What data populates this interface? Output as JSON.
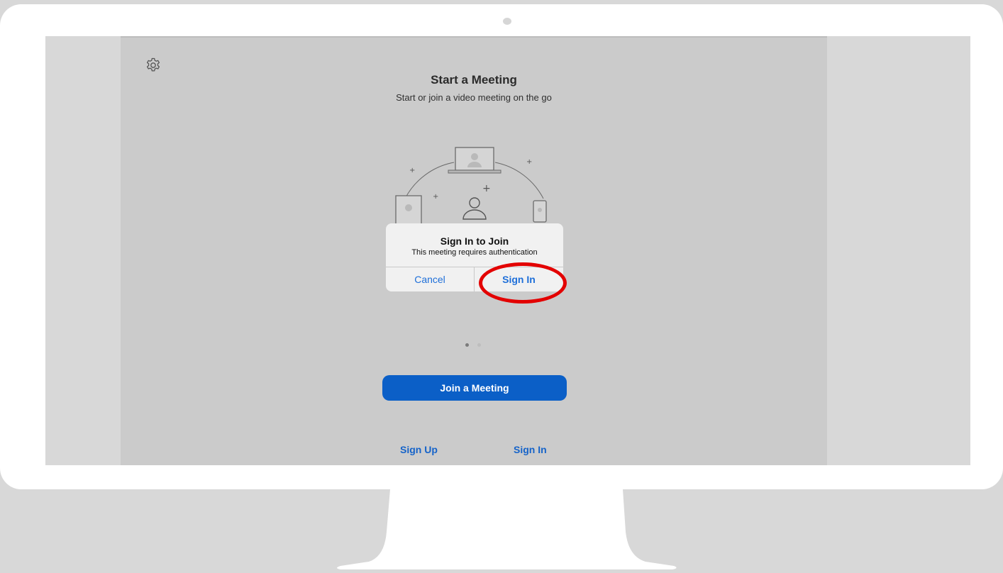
{
  "app": {
    "title": "Start a Meeting",
    "subtitle": "Start or join a video meeting on the go"
  },
  "icons": {
    "settings": "gear-icon"
  },
  "dialog": {
    "title": "Sign In to Join",
    "message": "This meeting requires authentication",
    "cancel_label": "Cancel",
    "signin_label": "Sign In"
  },
  "pagination": {
    "current_page": 1,
    "total_pages": 2
  },
  "actions": {
    "join_label": "Join a Meeting",
    "signup_label": "Sign Up",
    "signin_label": "Sign In"
  },
  "colors": {
    "accent": "#0b5fc7",
    "link": "#1e6fd9",
    "highlight": "#e30000",
    "background": "#cbcbcb"
  }
}
